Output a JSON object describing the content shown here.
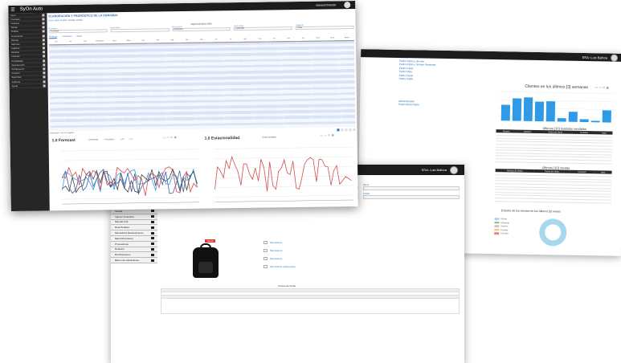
{
  "right_window": {
    "user_name": "ERA: Luis Balboa",
    "names_top": [
      "Pedro Pablo y Jimmie",
      "Pedro Pablo y Jimmie Panamas",
      "Pedro Pablo",
      "Pedro Moto",
      "Pedro Pablo",
      "Pedro Pablo"
    ],
    "names_bottom": [
      "Administrador",
      "Pedro Moto Pablo"
    ],
    "week_chart": {
      "title": "Clientes en los últimos [3] semanas",
      "values": [
        0.55,
        0.78,
        0.82,
        0.68,
        0.7,
        0.12,
        0.35,
        0.1,
        0.05,
        0.42
      ],
      "color": "#2f9be8"
    },
    "table1_title": "Últimos [10] modelos vendidos",
    "table1_headers": [
      "Modelo",
      "Nombre",
      "Fecha de Venta",
      "Cantidad",
      "Valor"
    ],
    "table2_title": "Últimos [10] Ventas",
    "table2_headers": [
      "Número de Venta",
      "Fecha de Venta",
      "Cantidad",
      "Valor"
    ],
    "pie_title": "Estados de los clientes en los últimos [3] meses",
    "pie_legend": [
      {
        "label": "Nuevo",
        "color": "#a8d8f0"
      },
      {
        "label": "Existente",
        "color": "#7fbf7f"
      },
      {
        "label": "Inactivo",
        "color": "#c9c9c9"
      },
      {
        "label": "Perdido",
        "color": "#f5b971"
      },
      {
        "label": "Cerrado",
        "color": "#f08080"
      }
    ]
  },
  "middle_window": {
    "user_name": "ERA: Luis Balboa",
    "side_items": [
      "Ventas",
      "Ingreso Inventario",
      "Manual Gral",
      "Ruta Pedidos",
      "Mercaderia Mantenimiento",
      "Mant Movimiento",
      "Proveedores",
      "Rotacion",
      "Bonificaciones",
      "Banco de cotizaciones"
    ],
    "fields": [
      {
        "label": "Artículo",
        "value": ""
      },
      {
        "label": "Descripción",
        "value": ""
      },
      {
        "label": "Marca",
        "value": ""
      },
      {
        "label": "Categoría",
        "value": "Producto"
      },
      {
        "label": "Línea",
        "value": ""
      },
      {
        "label": "Unidad",
        "value": ""
      }
    ],
    "product_tag": "Nuevo",
    "links": [
      "Mercadería",
      "Mercadería",
      "Mercadería",
      "Mercadería relacionada"
    ],
    "bottom_title": "Costos de Venta"
  },
  "front_window": {
    "logo": "SyOn Auto",
    "user": "ADMINISTRADOR",
    "page_title": "ELABORACIÓN Y PRONÓSTICO DE LA DEMANDA",
    "breadcrumb": [
      "Inicio",
      "Abrir Pedido",
      "Gestión Pedido"
    ],
    "search_title": "Opción Gestión ODA",
    "search_fields": [
      {
        "label": "Proveedor",
        "value": "Proveedor"
      },
      {
        "label": "Descripción",
        "value": ""
      },
      {
        "label": "Fecha Inicio",
        "value": "01/05/2021"
      },
      {
        "label": "Fecha Final",
        "value": "31/05/2021"
      },
      {
        "label": "Categoría",
        "value": "Todas"
      }
    ],
    "tabs": [
      "Producto",
      "Pronóstico",
      "Stock"
    ],
    "sidebar_items": [
      "Inicio",
      "Inventario",
      "Compras",
      "Ventas",
      "Pedidos",
      "Proveedores",
      "Clientes",
      "Reportes",
      "Logística",
      "Almacén",
      "Finanzas",
      "Contabilidad",
      "Importaciones",
      "Configuración",
      "Usuarios",
      "Seguridad",
      "Auditoría",
      "Ayuda"
    ],
    "grid_headers": [
      "Sel",
      "Art.",
      "Cód.",
      "Descripción",
      "Línea",
      "Marca",
      "Ene",
      "Feb",
      "Mar",
      "Abr",
      "May",
      "Jun",
      "Jul",
      "Ago",
      "Sep",
      "Oct",
      "Nov",
      "Dic",
      "Prom",
      "Stock",
      "Pedido"
    ],
    "grid_rows": 30,
    "pager_text": "Mostrando 1 de 200 registros",
    "chart1": {
      "title": "1.0 Forecast",
      "legend": [
        "Demanda",
        "Pronóstico",
        "LS",
        "LI"
      ],
      "series_colors": [
        "#3b5ea8",
        "#2f9be8",
        "#d94a4a",
        "#444444"
      ]
    },
    "chart2": {
      "title": "1.0 Estacionalidad",
      "legend": [
        "Estacionalidad"
      ],
      "series_color": "#d94a4a"
    }
  }
}
